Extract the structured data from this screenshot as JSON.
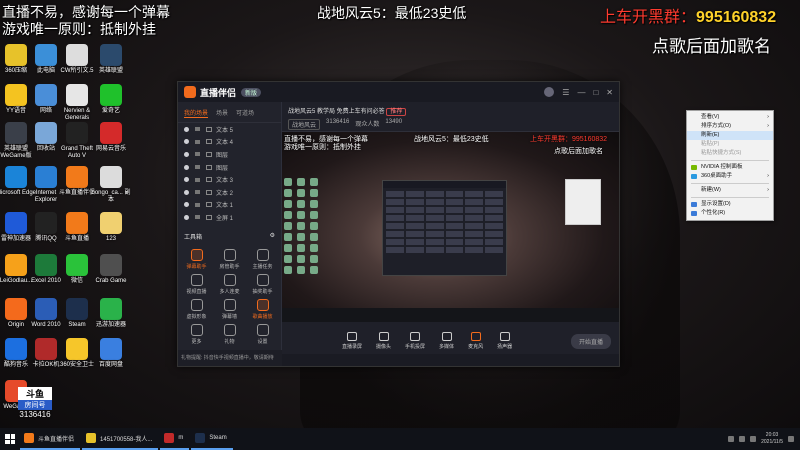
{
  "overlay": {
    "top_left_1": "直播不易，感谢每一个弹幕",
    "top_left_2": "游戏唯一原则：抵制外挂",
    "top_center": "战地风云5：最低23史低",
    "group_label": "上车开黑群：",
    "group_number": "995160832",
    "song_request": "点歌后面加歌名"
  },
  "desktop_icons": [
    {
      "label": "360压缩",
      "color": "#e7c22a"
    },
    {
      "label": "此电脑",
      "color": "#3b8fd8"
    },
    {
      "label": "CW所引文.5",
      "color": "#ddd"
    },
    {
      "label": "英雄联盟",
      "color": "#2b4a6c"
    },
    {
      "label": "YY语音",
      "color": "#f4c320"
    },
    {
      "label": "网络",
      "color": "#4a8ed8"
    },
    {
      "label": "Nervien & Generals",
      "color": "#e6e6e6"
    },
    {
      "label": "爱奇艺",
      "color": "#1fc12b"
    },
    {
      "label": "英雄联盟WeGame版",
      "color": "#3a3f49"
    },
    {
      "label": "回收站",
      "color": "#7aa7d8"
    },
    {
      "label": "Grand Theft Auto V",
      "color": "#222"
    },
    {
      "label": "网易云音乐",
      "color": "#d42a2a"
    },
    {
      "label": "Microsoft Edge",
      "color": "#1b84d8"
    },
    {
      "label": "Internet Explorer",
      "color": "#2a7fd4"
    },
    {
      "label": "斗鱼直播伴侣",
      "color": "#f27a1a"
    },
    {
      "label": "bongo_ca... 副本",
      "color": "#dcdcdc"
    },
    {
      "label": "雷神加速器",
      "color": "#1f5ad8"
    },
    {
      "label": "腾讯QQ",
      "color": "#222"
    },
    {
      "label": "斗鱼直播",
      "color": "#f27a1a"
    },
    {
      "label": "123",
      "color": "#f0d070"
    },
    {
      "label": "LeiGodlau...",
      "color": "#f6a11a"
    },
    {
      "label": "Excel 2010",
      "color": "#1d7a3a"
    },
    {
      "label": "微信",
      "color": "#2ac23a"
    },
    {
      "label": "Crab Game",
      "color": "#4f4f4f"
    },
    {
      "label": "Origin",
      "color": "#f46a1c"
    },
    {
      "label": "Word 2010",
      "color": "#2b5db6"
    },
    {
      "label": "Steam",
      "color": "#1d2f4c"
    },
    {
      "label": "迅游加速器",
      "color": "#2ab24a"
    },
    {
      "label": "酷狗音乐",
      "color": "#1c6fe0"
    },
    {
      "label": "卡拉OK机",
      "color": "#b02a2a"
    },
    {
      "label": "360安全卫士",
      "color": "#f6c62a"
    },
    {
      "label": "百度网盘",
      "color": "#3a7fe0"
    },
    {
      "label": "WeGame",
      "color": "#e64a2a"
    }
  ],
  "app": {
    "name": "直播伴侣",
    "version": "新版",
    "tabs": [
      "我的场景",
      "场景",
      "可道场"
    ],
    "scenes": [
      "文本 5",
      "文本 4",
      "图层",
      "图层",
      "文本 3",
      "文本 2",
      "文本 1",
      "全屏 1"
    ],
    "tools_header": "工具箱",
    "tools": [
      {
        "label": "弹幕助手",
        "orange": true
      },
      {
        "label": "房管助手",
        "orange": false
      },
      {
        "label": "主播任务",
        "orange": false
      },
      {
        "label": "视频直播",
        "orange": false
      },
      {
        "label": "多人连麦",
        "orange": false
      },
      {
        "label": "抽奖助手",
        "orange": false
      },
      {
        "label": "虚拟形象",
        "orange": false
      },
      {
        "label": "弹幕墙",
        "orange": false
      },
      {
        "label": "歌曲播放",
        "orange": true
      },
      {
        "label": "更多",
        "orange": false
      },
      {
        "label": "礼物",
        "orange": false
      },
      {
        "label": "设置",
        "orange": false
      }
    ],
    "left_status": "礼物提醒: 抖音快手视频直播中，敬请期待",
    "room_title": "战地风云5 教学局 免费上车有问必答",
    "room_tag": "推荐",
    "room_id": "3136416",
    "category_tag": "战地风云",
    "online_label": "观众人数",
    "online_count": "13490",
    "preview_texts": {
      "tl1": "直播不易，感谢每一个弹幕",
      "tl2": "游戏唯一原则：抵制外挂",
      "tc": "战地风云5：最低23史低",
      "tr1": "上车开黑群：995160832",
      "tr2": "点歌后面加歌名"
    },
    "controls": [
      "直播录屏",
      "摄像头",
      "手机投屏",
      "多媒体",
      "麦克风",
      "扬声器"
    ],
    "start_button": "开始直播"
  },
  "context_menu": {
    "items": [
      {
        "label": "查看(V)",
        "arrow": true,
        "disabled": false,
        "highlight": false
      },
      {
        "label": "排序方式(O)",
        "arrow": true,
        "disabled": false,
        "highlight": false
      },
      {
        "label": "刷新(E)",
        "arrow": false,
        "disabled": false,
        "highlight": true
      },
      {
        "label": "粘贴(P)",
        "arrow": false,
        "disabled": true,
        "highlight": false
      },
      {
        "label": "粘贴快捷方式(S)",
        "arrow": false,
        "disabled": true,
        "highlight": false
      },
      {
        "sep": true
      },
      {
        "label": "NVIDIA 控制面板",
        "arrow": false,
        "disabled": false,
        "highlight": false,
        "icon": "#76b900"
      },
      {
        "label": "360桌面助手",
        "arrow": true,
        "disabled": false,
        "highlight": false,
        "icon": "#2b9ae0"
      },
      {
        "sep": true
      },
      {
        "label": "新建(W)",
        "arrow": true,
        "disabled": false,
        "highlight": false
      },
      {
        "sep": true
      },
      {
        "label": "显示设置(D)",
        "arrow": false,
        "disabled": false,
        "highlight": false,
        "icon": "#3b7bd8"
      },
      {
        "label": "个性化(R)",
        "arrow": false,
        "disabled": false,
        "highlight": false,
        "icon": "#3b7bd8"
      }
    ]
  },
  "badge": {
    "brand": "斗鱼",
    "label": "房间号",
    "room": "3136416"
  },
  "taskbar": {
    "items": [
      {
        "label": "斗鱼直播伴侣",
        "color": "#f27a1a"
      },
      {
        "label": "1451700558-我人...",
        "color": "#e7c22a"
      },
      {
        "label": "m",
        "color": "#c22a2a"
      },
      {
        "label": "Steam",
        "color": "#1d2f4c"
      }
    ],
    "time": "20:03",
    "date": "2021/11/5"
  }
}
